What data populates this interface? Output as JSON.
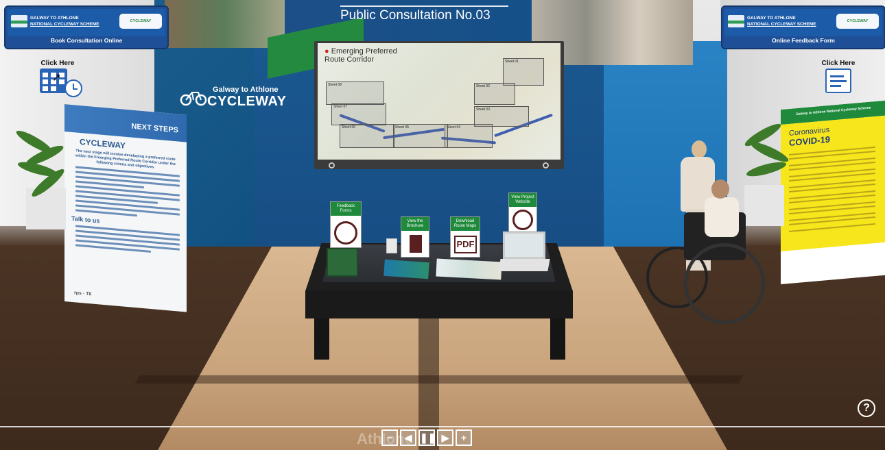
{
  "consultation": {
    "title": "Public Consultation No.03"
  },
  "header_left": {
    "scheme_line1": "GALWAY TO ATHLONE",
    "scheme_line2": "NATIONAL CYCLEWAY SCHEME",
    "badge": "CYCLEWAY",
    "label": "Book Consultation Online",
    "click_here": "Click Here"
  },
  "header_right": {
    "scheme_line1": "GALWAY TO ATHLONE",
    "scheme_line2": "NATIONAL CYCLEWAY SCHEME",
    "badge": "CYCLEWAY",
    "label": "Online Feedback Form",
    "click_here": "Click Here"
  },
  "stand_logo": {
    "line1": "Galway to Athlone",
    "line2": "CYCLEWAY"
  },
  "map_screen": {
    "title_line1": "Emerging Preferred",
    "title_line2": "Route Corridor",
    "sheets": [
      "Sheet 01",
      "Sheet 02",
      "Sheet 03",
      "Sheet 04",
      "Sheet 05",
      "Sheet 06",
      "Sheet 07",
      "Sheet 08"
    ]
  },
  "banner_left": {
    "heading": "NEXT STEPS",
    "logo": "CYCLEWAY",
    "lead": "The next stage will involve developing a preferred route within the Emerging Preferred Route Corridor under the following criteria and objectives.",
    "subheading": "Talk to us",
    "footer": "rps · TII"
  },
  "banner_right": {
    "top": "Galway to Athlone National Cycleway Scheme",
    "title1": "Coronavirus",
    "title2": "COVID-19"
  },
  "kiosk": {
    "feedback": "Feedback Forms",
    "brochure": "View the Brochure",
    "maps": "Download Route Maps",
    "website": "View Project Website",
    "pdf": "PDF"
  },
  "controls": {
    "zoom_out": "−",
    "prev": "◀",
    "pause": "❚❚",
    "next": "▶",
    "zoom_in": "+",
    "watermark": "Athlone"
  },
  "help": {
    "label": "?"
  },
  "colors": {
    "brand_blue": "#1f4f96",
    "brand_green": "#1f8a3c",
    "covid_yellow": "#f7e61b"
  }
}
